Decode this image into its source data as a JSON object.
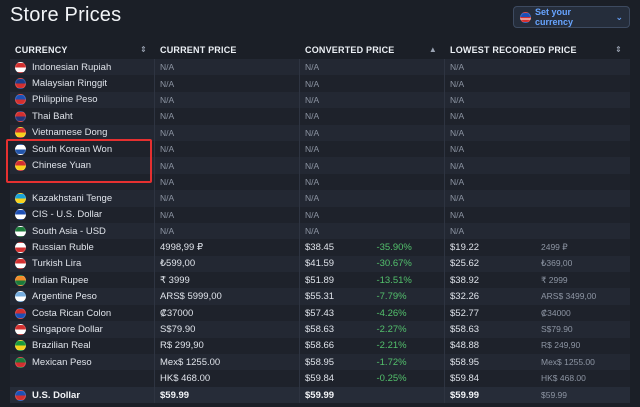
{
  "page": {
    "title": "Store Prices",
    "currency_button": {
      "label": "Set your currency",
      "flag": "us-flag-icon"
    }
  },
  "columns": [
    {
      "label": "CURRENCY",
      "sort": "⇕"
    },
    {
      "label": "CURRENT PRICE",
      "sort": ""
    },
    {
      "label": "CONVERTED PRICE",
      "sort": "▲"
    },
    {
      "label": "LOWEST RECORDED PRICE",
      "sort": "⇕"
    }
  ],
  "rows": [
    {
      "name": "Indonesian Rupiah",
      "flag": [
        "#d32f2f",
        "#ffffff"
      ],
      "current": "N/A",
      "converted": "N/A",
      "pct": "",
      "lowest": "N/A",
      "lowest_local": ""
    },
    {
      "name": "Malaysian Ringgit",
      "flag": [
        "#1a3e8c",
        "#d32f2f"
      ],
      "current": "N/A",
      "converted": "N/A",
      "pct": "",
      "lowest": "N/A",
      "lowest_local": ""
    },
    {
      "name": "Philippine Peso",
      "flag": [
        "#1d4fb5",
        "#d32f2f"
      ],
      "current": "N/A",
      "converted": "N/A",
      "pct": "",
      "lowest": "N/A",
      "lowest_local": ""
    },
    {
      "name": "Thai Baht",
      "flag": [
        "#d32f2f",
        "#24357a"
      ],
      "current": "N/A",
      "converted": "N/A",
      "pct": "",
      "lowest": "N/A",
      "lowest_local": ""
    },
    {
      "name": "Vietnamese Dong",
      "flag": [
        "#d32f2f",
        "#f7d11b"
      ],
      "current": "N/A",
      "converted": "N/A",
      "pct": "",
      "lowest": "N/A",
      "lowest_local": ""
    },
    {
      "name": "South Korean Won",
      "flag": [
        "#ffffff",
        "#2255aa"
      ],
      "current": "N/A",
      "converted": "N/A",
      "pct": "",
      "lowest": "N/A",
      "lowest_local": ""
    },
    {
      "name": "Chinese Yuan",
      "flag": [
        "#d32f2f",
        "#f7d11b"
      ],
      "current": "N/A",
      "converted": "N/A",
      "pct": "",
      "lowest": "N/A",
      "lowest_local": ""
    },
    {
      "name": "",
      "flag": [],
      "current": "N/A",
      "converted": "N/A",
      "pct": "",
      "lowest": "N/A",
      "lowest_local": ""
    },
    {
      "name": "Kazakhstani Tenge",
      "flag": [
        "#1aa3d6",
        "#f7d11b"
      ],
      "current": "N/A",
      "converted": "N/A",
      "pct": "",
      "lowest": "N/A",
      "lowest_local": ""
    },
    {
      "name": "CIS - U.S. Dollar",
      "flag": [
        "#1d4fb5",
        "#ffffff"
      ],
      "current": "N/A",
      "converted": "N/A",
      "pct": "",
      "lowest": "N/A",
      "lowest_local": ""
    },
    {
      "name": "South Asia - USD",
      "flag": [
        "#1b7a3a",
        "#ffffff"
      ],
      "current": "N/A",
      "converted": "N/A",
      "pct": "",
      "lowest": "N/A",
      "lowest_local": ""
    },
    {
      "name": "Russian Ruble",
      "flag": [
        "#ffffff",
        "#d32f2f"
      ],
      "current": "4998,99 ₽",
      "converted": "$38.45",
      "pct": "-35.90%",
      "lowest": "$19.22",
      "lowest_local": "2499 ₽"
    },
    {
      "name": "Turkish Lira",
      "flag": [
        "#d32f2f",
        "#ffffff"
      ],
      "current": "₺599,00",
      "converted": "$41.59",
      "pct": "-30.67%",
      "lowest": "$25.62",
      "lowest_local": "₺369,00"
    },
    {
      "name": "Indian Rupee",
      "flag": [
        "#f28c28",
        "#1b7a3a"
      ],
      "current": "₹ 3999",
      "converted": "$51.89",
      "pct": "-13.51%",
      "lowest": "$38.92",
      "lowest_local": "₹ 2999"
    },
    {
      "name": "Argentine Peso",
      "flag": [
        "#74acdf",
        "#ffffff"
      ],
      "current": "ARS$ 5999,00",
      "converted": "$55.31",
      "pct": "-7.79%",
      "lowest": "$32.26",
      "lowest_local": "ARS$ 3499,00"
    },
    {
      "name": "Costa Rican Colon",
      "flag": [
        "#d32f2f",
        "#1d4fb5"
      ],
      "current": "₡37000",
      "converted": "$57.43",
      "pct": "-4.26%",
      "lowest": "$52.77",
      "lowest_local": "₡34000"
    },
    {
      "name": "Singapore Dollar",
      "flag": [
        "#d32f2f",
        "#ffffff"
      ],
      "current": "S$79.90",
      "converted": "$58.63",
      "pct": "-2.27%",
      "lowest": "$58.63",
      "lowest_local": "S$79.90"
    },
    {
      "name": "Brazilian Real",
      "flag": [
        "#1b9a3a",
        "#f7d11b"
      ],
      "current": "R$ 299,90",
      "converted": "$58.66",
      "pct": "-2.21%",
      "lowest": "$48.88",
      "lowest_local": "R$ 249,90"
    },
    {
      "name": "Mexican Peso",
      "flag": [
        "#1b7a3a",
        "#d32f2f"
      ],
      "current": "Mex$ 1255.00",
      "converted": "$58.95",
      "pct": "-1.72%",
      "lowest": "$58.95",
      "lowest_local": "Mex$ 1255.00"
    },
    {
      "name": "",
      "flag": [],
      "current": "HK$ 468.00",
      "converted": "$59.84",
      "pct": "-0.25%",
      "lowest": "$59.84",
      "lowest_local": "HK$ 468.00"
    },
    {
      "name": "U.S. Dollar",
      "flag": [
        "#1d4fb5",
        "#d32f2f"
      ],
      "current": "$59.99",
      "converted": "$59.99",
      "pct": "",
      "lowest": "$59.99",
      "lowest_local": "$59.99",
      "bold": true
    }
  ],
  "colors": {
    "highlight": "#e53030",
    "accent": "#67a4ff",
    "positive": "#53c06c"
  }
}
